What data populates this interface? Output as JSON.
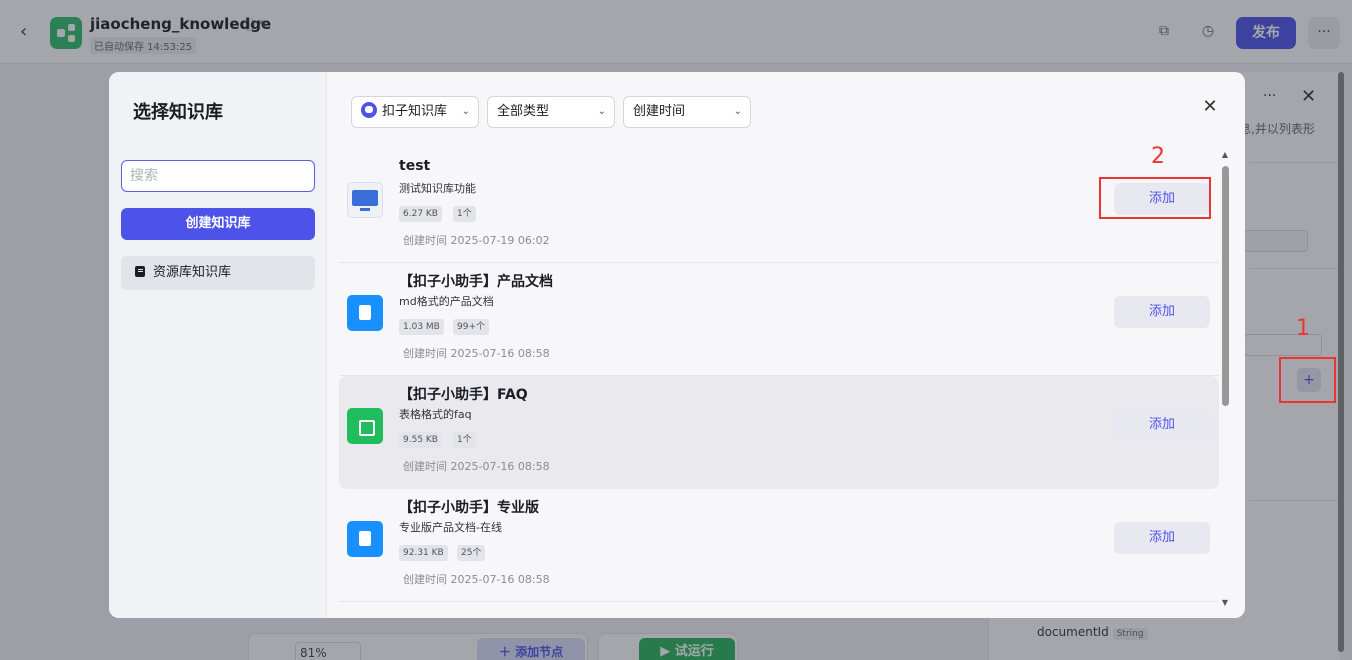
{
  "header": {
    "back_icon": "chevron-left-icon",
    "app_name": "jiaocheng_knowledge",
    "autosave": "已自动保存 14:53:25",
    "publish_label": "发布",
    "more_label": "···"
  },
  "bg_panel": {
    "text": "息,并以列表形",
    "param_name": "documentId",
    "param_type": "String"
  },
  "toolbar": {
    "zoom": "81%",
    "add_node": "＋ 添加节点",
    "run": "▶ 试运行"
  },
  "modal": {
    "title": "选择知识库",
    "search_placeholder": "搜索",
    "create_label": "创建知识库",
    "side_item": "资源库知识库",
    "filters": [
      "扣子知识库",
      "全部类型",
      "创建时间"
    ],
    "close_icon": "close-icon",
    "items": [
      {
        "name": "test",
        "desc": "测试知识库功能",
        "size": "6.27 KB",
        "count": "1个",
        "time": "创建时间 2025-07-19 06:02",
        "icon": "image-kb-icon",
        "add": "添加"
      },
      {
        "name": "【扣子小助手】产品文档",
        "desc": "md格式的产品文档",
        "size": "1.03 MB",
        "count": "99+个",
        "time": "创建时间 2025-07-16 08:58",
        "icon": "doc-icon",
        "add": "添加"
      },
      {
        "name": "【扣子小助手】FAQ",
        "desc": "表格格式的faq",
        "size": "9.55 KB",
        "count": "1个",
        "time": "创建时间 2025-07-16 08:58",
        "icon": "sheet-icon",
        "add": "添加"
      },
      {
        "name": "【扣子小助手】专业版",
        "desc": "专业版产品文档-在线",
        "size": "92.31 KB",
        "count": "25个",
        "time": "创建时间 2025-07-16 08:58",
        "icon": "doc-icon",
        "add": "添加"
      }
    ]
  },
  "annotations": {
    "one": "1",
    "two": "2"
  },
  "colors": {
    "accent": "#4d53e8",
    "annotation": "#e33333",
    "publish": "#4d53e8",
    "run": "#27b45a"
  }
}
